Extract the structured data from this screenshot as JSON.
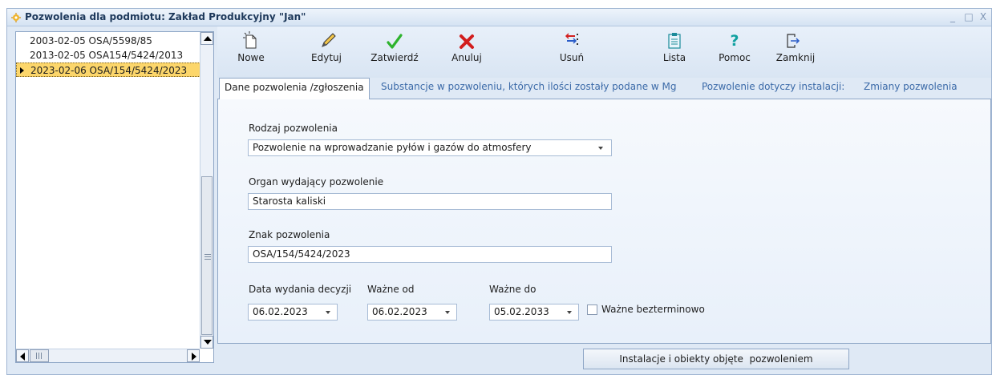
{
  "window": {
    "title": "Pozwolenia dla podmiotu: Zakład Produkcyjny \"Jan\"",
    "minimize": "_",
    "maximize": "□",
    "close": "X"
  },
  "list": {
    "items": [
      {
        "label": "2003-02-05 OSA/5598/85"
      },
      {
        "label": "2013-02-05 OSA154/5424/2013"
      },
      {
        "label": "2023-02-06 OSA/154/5424/2023",
        "selected": true
      }
    ]
  },
  "toolbar": {
    "new": "Nowe",
    "edit": "Edytuj",
    "confirm": "Zatwierdź",
    "cancel": "Anuluj",
    "delete": "Usuń",
    "list": "Lista",
    "help": "Pomoc",
    "close": "Zamknij"
  },
  "tabs": [
    {
      "label": "Dane pozwolenia /zgłoszenia",
      "active": true
    },
    {
      "label": "Substancje w pozwoleniu, których ilości zostały podane w Mg"
    },
    {
      "label": "Pozwolenie dotyczy instalacji:"
    },
    {
      "label": "Zmiany pozwolenia"
    }
  ],
  "form": {
    "permit_type_label": "Rodzaj pozwolenia",
    "permit_type_value": "Pozwolenie na wprowadzanie pyłów i gazów do atmosfery",
    "issuer_label": "Organ wydający pozwolenie",
    "issuer_value": "Starosta kaliski",
    "permit_no_label": "Znak pozwolenia",
    "permit_no_value": "OSA/154/5424/2023",
    "issue_date_label": "Data wydania decyzji",
    "issue_date_value": "06.02.2023",
    "valid_from_label": "Ważne od",
    "valid_from_value": "06.02.2023",
    "valid_to_label": "Ważne do",
    "valid_to_value": "05.02.2033",
    "indefinite_label": "Ważne bezterminowo"
  },
  "bottom_button": "Instalacje i obiekty objęte  pozwoleniem",
  "colors": {
    "selected_row": "#fcd66b",
    "window_bg": "#dfe9f5",
    "tab_link": "#3b6aa8",
    "ok_green": "#2db32d",
    "cancel_red": "#d21e1e",
    "help_teal": "#10a0a0"
  }
}
